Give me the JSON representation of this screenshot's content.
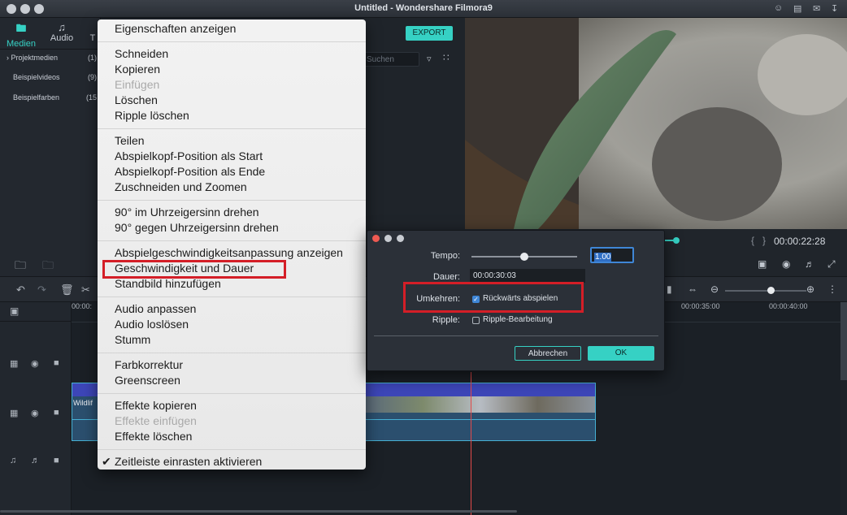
{
  "window": {
    "title": "Untitled - Wondershare Filmora9"
  },
  "media_tabs": [
    {
      "label": "Medien",
      "icon": "folder-icon"
    },
    {
      "label": "Audio",
      "icon": "music-icon"
    },
    {
      "label": "T",
      "icon": "text-icon"
    }
  ],
  "media_list": [
    {
      "label": "Projektmedien",
      "count": "(1)"
    },
    {
      "label": "Beispielvideos",
      "count": "(9)"
    },
    {
      "label": "Beispielfarben",
      "count": "(15"
    }
  ],
  "toolbar": {
    "export_label": "EXPORT",
    "search_placeholder": "Suchen"
  },
  "preview": {
    "timecode": "00:00:22:28"
  },
  "ruler": [
    "00:00:",
    "00:00:35:00",
    "00:00:40:00"
  ],
  "clip": {
    "label": "Wildlif"
  },
  "context_menu": {
    "items": [
      {
        "label": "Eigenschaften anzeigen",
        "enabled": true
      },
      {
        "label": "Schneiden",
        "enabled": true
      },
      {
        "label": "Kopieren",
        "enabled": true
      },
      {
        "label": "Einfügen",
        "enabled": false
      },
      {
        "label": "Löschen",
        "enabled": true
      },
      {
        "label": "Ripple löschen",
        "enabled": true
      },
      {
        "label": "Teilen",
        "enabled": true
      },
      {
        "label": "Abspielkopf-Position als Start",
        "enabled": true
      },
      {
        "label": "Abspielkopf-Position als Ende",
        "enabled": true
      },
      {
        "label": "Zuschneiden und Zoomen",
        "enabled": true
      },
      {
        "label": "90° im Uhrzeigersinn drehen",
        "enabled": true
      },
      {
        "label": "90° gegen Uhrzeigersinn drehen",
        "enabled": true
      },
      {
        "label": "Abspielgeschwindigkeitsanpassung anzeigen",
        "enabled": true
      },
      {
        "label": "Geschwindigkeit und Dauer",
        "enabled": true,
        "highlighted": true
      },
      {
        "label": "Standbild hinzufügen",
        "enabled": true
      },
      {
        "label": "Audio anpassen",
        "enabled": true
      },
      {
        "label": "Audio loslösen",
        "enabled": true
      },
      {
        "label": "Stumm",
        "enabled": true
      },
      {
        "label": "Farbkorrektur",
        "enabled": true
      },
      {
        "label": "Greenscreen",
        "enabled": true
      },
      {
        "label": "Effekte kopieren",
        "enabled": true
      },
      {
        "label": "Effekte einfügen",
        "enabled": false
      },
      {
        "label": "Effekte löschen",
        "enabled": true
      },
      {
        "label": "Zeitleiste einrasten aktivieren",
        "enabled": true,
        "checked": true
      }
    ]
  },
  "speed_dialog": {
    "tempo_label": "Tempo:",
    "tempo_value": "1.00",
    "tempo_level": 0.5,
    "dauer_label": "Dauer:",
    "dauer_value": "00:00:30:03",
    "umkehren_label": "Umkehren:",
    "umkehren_option": "Rückwärts abspielen",
    "umkehren_checked": true,
    "ripple_label": "Ripple:",
    "ripple_option": "Ripple-Bearbeitung",
    "ripple_checked": false,
    "cancel_label": "Abbrechen",
    "ok_label": "OK"
  },
  "colors": {
    "accent": "#36d1c4",
    "highlight_box": "#d41e27",
    "playhead": "#e34a4a",
    "timeline_clip": "#2b4f6e"
  }
}
